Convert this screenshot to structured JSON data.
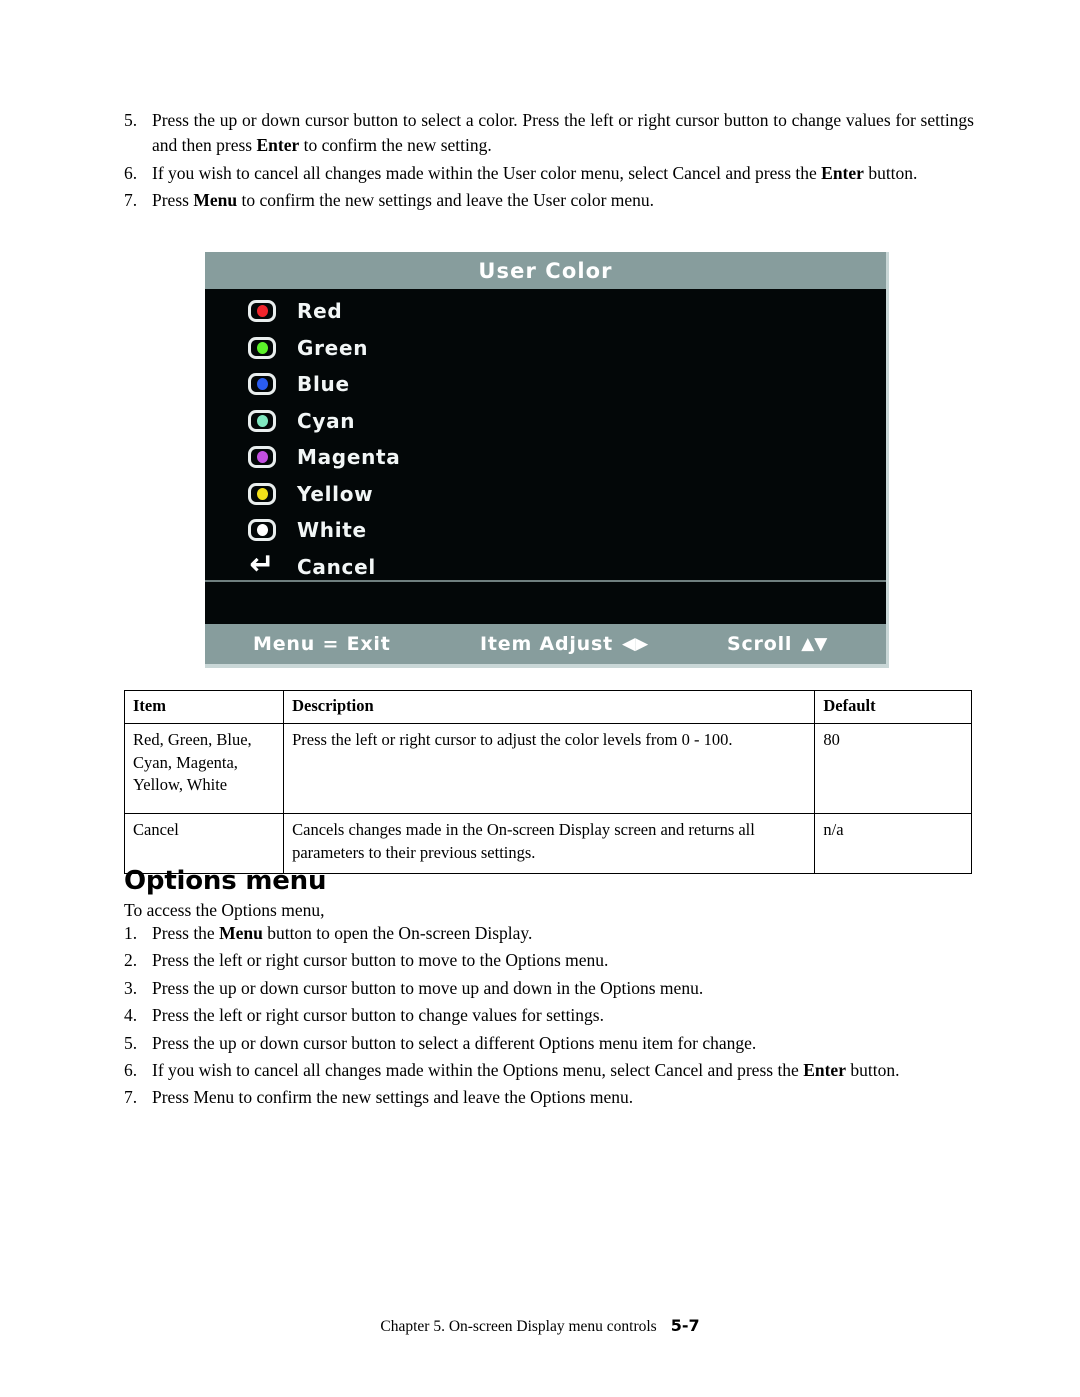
{
  "steps_top": [
    {
      "num": "5.",
      "parts": [
        {
          "t": "Press the up or down cursor button to select a color. Press the left or right cursor button to change values for settings and then press ",
          "b": false
        },
        {
          "t": "Enter",
          "b": true
        },
        {
          "t": " to confirm the new setting.",
          "b": false
        }
      ]
    },
    {
      "num": "6.",
      "parts": [
        {
          "t": "If you wish to cancel all changes made within the User color menu, select Cancel and press the ",
          "b": false
        },
        {
          "t": "Enter",
          "b": true
        },
        {
          "t": " button.",
          "b": false
        }
      ]
    },
    {
      "num": "7.",
      "parts": [
        {
          "t": "Press ",
          "b": false
        },
        {
          "t": "Menu",
          "b": true
        },
        {
          "t": " to confirm the new settings and leave the User color menu.",
          "b": false
        }
      ]
    }
  ],
  "osd": {
    "title": "User Color",
    "items": [
      {
        "label": "Red",
        "icon": "led-icon",
        "color": "#f0252c"
      },
      {
        "label": "Green",
        "icon": "led-icon",
        "color": "#5bf22a"
      },
      {
        "label": "Blue",
        "icon": "led-icon",
        "color": "#2a5cf0"
      },
      {
        "label": "Cyan",
        "icon": "led-icon",
        "color": "#7fe8c0"
      },
      {
        "label": "Magenta",
        "icon": "led-icon",
        "color": "#c24fe0"
      },
      {
        "label": "Yellow",
        "icon": "led-icon",
        "color": "#f2e019"
      },
      {
        "label": "White",
        "icon": "led-icon",
        "color": "#ffffff"
      },
      {
        "label": "Cancel",
        "icon": "return-icon",
        "color": "#ffffff"
      }
    ],
    "footer": {
      "exit": "Menu = Exit",
      "adjust": "Item Adjust",
      "adjust_arrows": "◀▶",
      "scroll": "Scroll",
      "scroll_arrows": "▲▼"
    },
    "colors": {
      "bar": "#879d9d",
      "screen": "#030708",
      "text": "#f2f6f6"
    }
  },
  "table": {
    "headers": [
      "Item",
      "Description",
      "Default"
    ],
    "rows": [
      {
        "item": "Red, Green, Blue, Cyan, Magenta, Yellow, White",
        "description": "Press the left or right cursor to adjust the color levels from 0 - 100.",
        "default": "80"
      },
      {
        "item": "Cancel",
        "description": "Cancels changes made in the On-screen Display screen and returns all parameters to their previous settings.",
        "default": "n/a"
      }
    ]
  },
  "section": {
    "heading": "Options menu",
    "intro": "To access the Options menu,"
  },
  "steps_bottom": [
    {
      "num": "1.",
      "parts": [
        {
          "t": "Press the ",
          "b": false
        },
        {
          "t": "Menu",
          "b": true
        },
        {
          "t": " button to open the On-screen Display.",
          "b": false
        }
      ]
    },
    {
      "num": "2.",
      "parts": [
        {
          "t": "Press the left or right cursor button to move to the Options menu.",
          "b": false
        }
      ]
    },
    {
      "num": "3.",
      "parts": [
        {
          "t": "Press the up or down cursor button to move up and down in the Options menu.",
          "b": false
        }
      ]
    },
    {
      "num": "4.",
      "parts": [
        {
          "t": "Press the left or right cursor button to change values for settings.",
          "b": false
        }
      ]
    },
    {
      "num": "5.",
      "parts": [
        {
          "t": "Press the up or down cursor button to select a different Options menu item for change.",
          "b": false
        }
      ]
    },
    {
      "num": "6.",
      "parts": [
        {
          "t": "If you wish to cancel all changes made within the Options menu, select Cancel and press the ",
          "b": false
        },
        {
          "t": "Enter",
          "b": true
        },
        {
          "t": " button.",
          "b": false
        }
      ]
    },
    {
      "num": "7.",
      "parts": [
        {
          "t": "Press Menu to confirm the new settings and leave the Options menu.",
          "b": false
        }
      ]
    }
  ],
  "footer": {
    "chapter": "Chapter 5. On-screen Display menu controls",
    "page": "5-7"
  }
}
